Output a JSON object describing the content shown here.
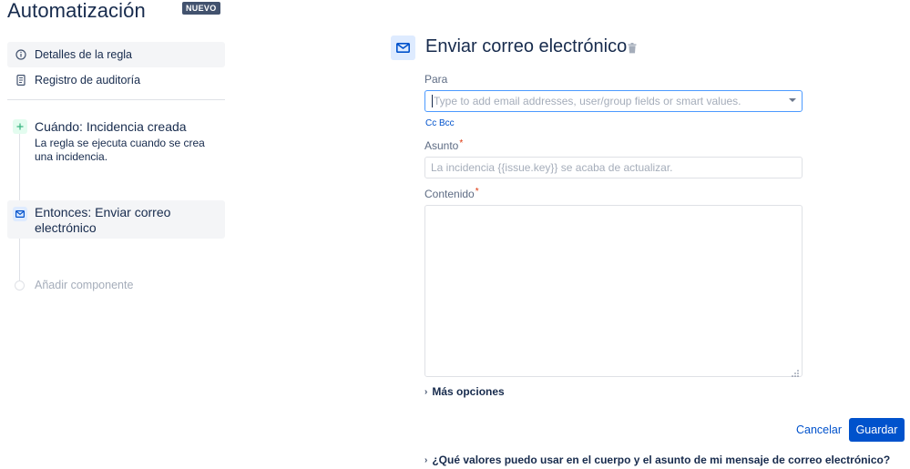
{
  "app": {
    "title": "Automatización",
    "badge": "NUEVO"
  },
  "nav": {
    "items": [
      {
        "label": "Detalles de la regla",
        "icon": "info-icon"
      },
      {
        "label": "Registro de auditoría",
        "icon": "document-icon"
      }
    ]
  },
  "flow": {
    "trigger": {
      "title": "Cuándo: Incidencia creada",
      "description": "La regla se ejecuta cuando se crea una incidencia.",
      "icon": "plus-icon",
      "color": "#36b37e"
    },
    "action": {
      "title": "Entonces: Enviar correo electrónico",
      "icon": "mail-icon",
      "color": "#0052cc"
    },
    "add_component": "Añadir componente"
  },
  "panel": {
    "title": "Enviar correo electrónico",
    "to": {
      "label": "Para",
      "value": "",
      "placeholder": "Type to add email addresses, user/group fields or smart values."
    },
    "cc_bcc": "Cc Bcc",
    "subject": {
      "label": "Asunto",
      "required": "*",
      "value": "",
      "placeholder": "La incidencia {{issue.key}} se acaba de actualizar."
    },
    "content": {
      "label": "Contenido",
      "required": "*",
      "value": ""
    },
    "more_options": "Más opciones",
    "help_link": "¿Qué valores puedo usar en el cuerpo y el asunto de mi mensaje de correo electrónico?"
  },
  "actions": {
    "cancel": "Cancelar",
    "save": "Guardar"
  },
  "colors": {
    "primary": "#0052cc",
    "text": "#172b4d",
    "badge_bg": "#42526e",
    "focus": "#4c9aff"
  }
}
